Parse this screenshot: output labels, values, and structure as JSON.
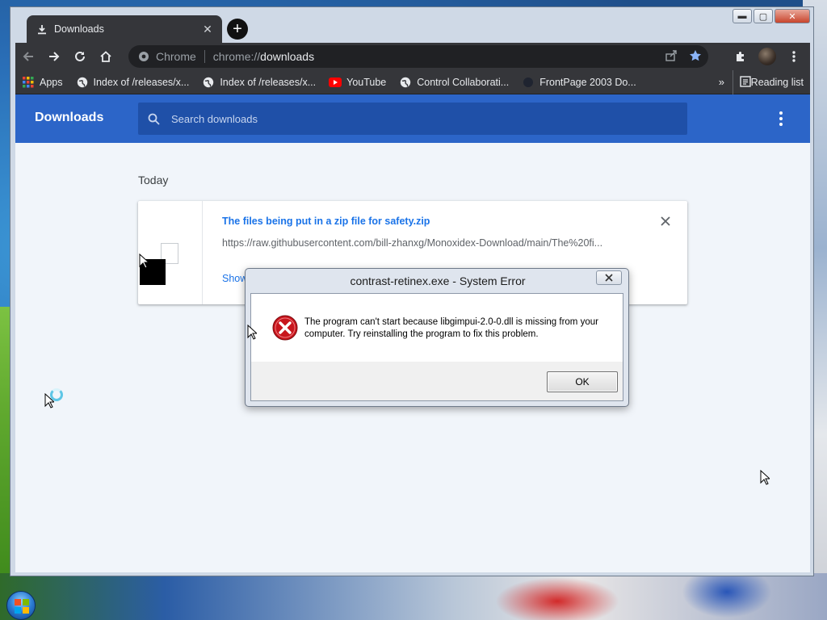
{
  "window": {
    "tab_title": "Downloads",
    "controls": {
      "minimize": "▬",
      "maximize": "▢",
      "close": "✕"
    }
  },
  "toolbar": {
    "site_label": "Chrome",
    "url_scheme": "chrome://",
    "url_path": "downloads"
  },
  "bookmarks": {
    "items": [
      {
        "label": "Apps",
        "icon": "apps-grid-icon"
      },
      {
        "label": "Index of /releases/x...",
        "icon": "globe-icon"
      },
      {
        "label": "Index of /releases/x...",
        "icon": "globe-icon"
      },
      {
        "label": "YouTube",
        "icon": "youtube-icon"
      },
      {
        "label": "Control Collaborati...",
        "icon": "globe-icon"
      },
      {
        "label": "FrontPage 2003 Do...",
        "icon": "dark-dot-icon"
      }
    ],
    "more": "»",
    "reading_list": "Reading list"
  },
  "downloads": {
    "title": "Downloads",
    "search_placeholder": "Search downloads",
    "section": "Today",
    "item": {
      "file_name": "The files being put in a zip file for safety.zip",
      "url": "https://raw.githubusercontent.com/bill-zhanxg/Monoxidex-Download/main/The%20fi...",
      "action": "Show in folder"
    }
  },
  "dialog": {
    "title": "contrast-retinex.exe - System Error",
    "message": "The program can't start because libgimpui-2.0-0.dll is missing from your computer. Try reinstalling the program to fix this problem.",
    "ok_label": "OK"
  },
  "colors": {
    "chrome_dark": "#35363a",
    "downloads_header": "#2c65c8",
    "link_blue": "#1a73e8",
    "error_red": "#c8161d"
  }
}
